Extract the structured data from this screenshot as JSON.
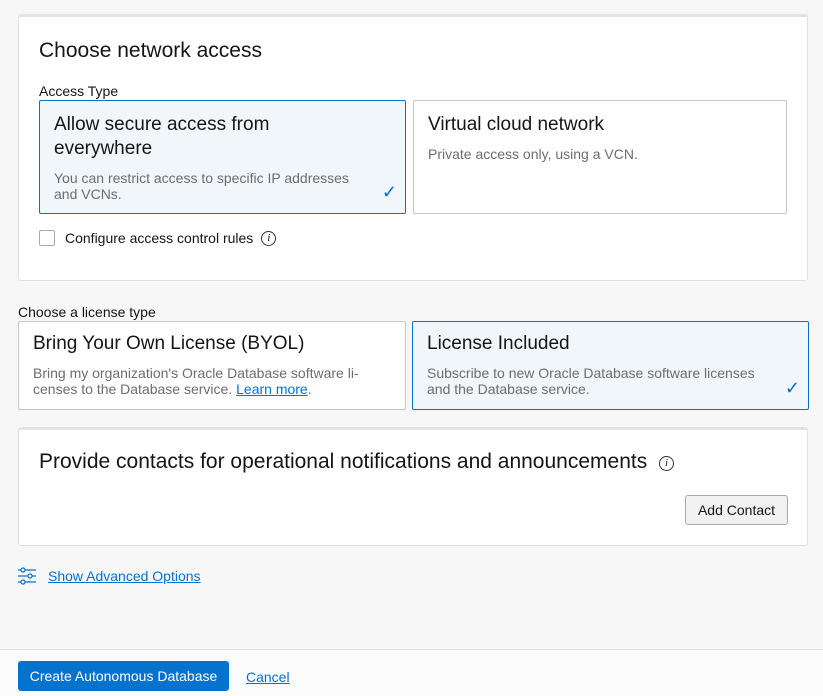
{
  "network": {
    "title": "Choose network access",
    "access_type_label": "Access Type",
    "options": [
      {
        "title": "Allow secure access from everywhere",
        "desc": "You can restrict access to specific IP addresses and VCNs."
      },
      {
        "title": "Virtual cloud network",
        "desc": "Private access only, using a VCN."
      }
    ],
    "acl_label": "Configure access control rules"
  },
  "license": {
    "label": "Choose a license type",
    "options": [
      {
        "title": "Bring Your Own License (BYOL)",
        "desc": "Bring my organization's Oracle Database software li-censes to the Database service.",
        "link": "Learn more"
      },
      {
        "title": "License Included",
        "desc": "Subscribe to new Oracle Database software licenses and the Database service."
      }
    ]
  },
  "contacts": {
    "title": "Provide contacts for operational notifications and announcements",
    "add_button": "Add Contact"
  },
  "advanced_link": "Show Advanced Options",
  "footer": {
    "create_button": "Create Autonomous Database",
    "cancel_link": "Cancel"
  }
}
